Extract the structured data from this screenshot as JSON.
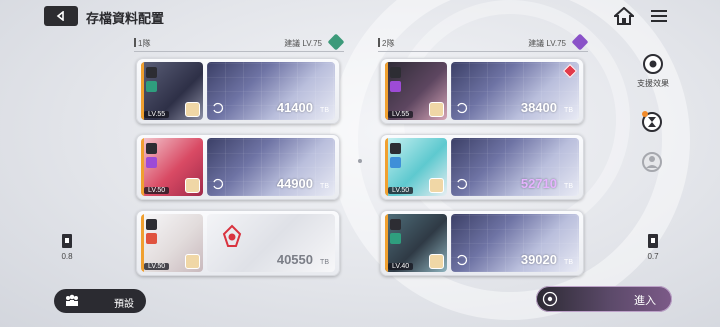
{
  "header": {
    "title": "存檔資料配置"
  },
  "teams": [
    {
      "name": "1隊",
      "level_label": "建議 LV.75",
      "badge_color": "#3c9a7a",
      "cards": [
        {
          "level": "LV.55",
          "power": "41400",
          "unit": "TB",
          "class_color": "#2f9e7e",
          "highlight": false,
          "plain": false
        },
        {
          "level": "LV.50",
          "power": "44900",
          "unit": "TB",
          "class_color": "#9d4bd6",
          "highlight": false,
          "plain": false
        },
        {
          "level": "LV.50",
          "power": "40550",
          "unit": "TB",
          "class_color": "#e0533f",
          "highlight": false,
          "plain": true
        }
      ]
    },
    {
      "name": "2隊",
      "level_label": "建議 LV.75",
      "badge_color": "#8a52c8",
      "cards": [
        {
          "level": "LV.55",
          "power": "38400",
          "unit": "TB",
          "class_color": "#9d4bd6",
          "highlight": false,
          "plain": false
        },
        {
          "level": "LV.50",
          "power": "52710",
          "unit": "TB",
          "class_color": "#3f8fd8",
          "highlight": true,
          "plain": false
        },
        {
          "level": "LV.40",
          "power": "39020",
          "unit": "TB",
          "class_color": "#2f9e7e",
          "highlight": false,
          "plain": false
        }
      ]
    }
  ],
  "side": {
    "left_value": "0.8",
    "right_value": "0.7",
    "support_label": "支援效果"
  },
  "bottom": {
    "preset_label": "預設",
    "enter_label": "進入"
  }
}
